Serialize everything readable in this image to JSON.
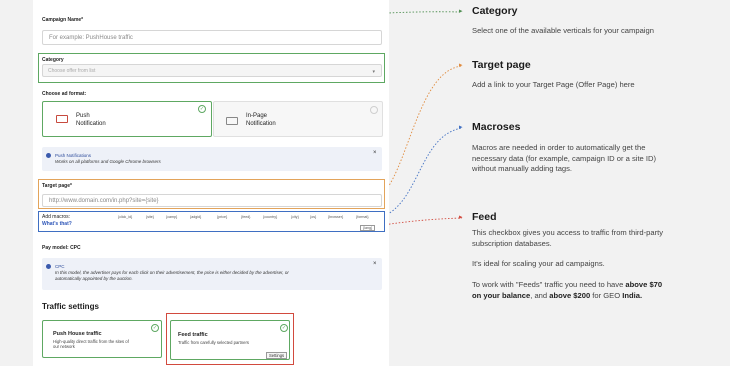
{
  "form": {
    "campaign_name_label": "Campaign Name*",
    "campaign_name_placeholder": "For example: PushHouse traffic",
    "category_label": "Category",
    "category_placeholder": "Choose offer from list",
    "ad_format_label": "Choose ad format:",
    "formats": [
      {
        "title_line1": "Push",
        "title_line2": "Notification",
        "selected": true
      },
      {
        "title_line1": "In-Page",
        "title_line2": "Notification",
        "selected": false
      }
    ],
    "push_note_title": "Push Notifications",
    "push_note_text": "Works on all platforms and Google Chrome browsers",
    "target_page_label": "Target page*",
    "target_page_value": "http://www.domain.com/in.php?site={site}",
    "add_macros_label": "Add macros:",
    "whats_that": "What's that?",
    "macros": [
      "{click_id}",
      "{site}",
      "{camp}",
      "{adgid}",
      "{price}",
      "{feed}",
      "{country}",
      "{city}",
      "{os}",
      "{browser}",
      "{format}"
    ],
    "macro_extra": "{lang}",
    "pay_model_label": "Pay model: CPC",
    "cpc_note_title": "CPC",
    "cpc_note_text_1": "In this model, the advertiser pays for each click on their advertisement, the price is either decided by the advertiser, or",
    "cpc_note_text_2": "automatically appointed by the auction.",
    "traffic_settings_title": "Traffic settings",
    "push_house_title": "Push House traffic",
    "push_house_desc_1": "High-quality direct traffic from the sites of",
    "push_house_desc_2": "our network",
    "feed_title": "Feed traffic",
    "feed_desc": "Traffic from carefully selected partners",
    "settings_label": "Settings",
    "close_symbol": "×"
  },
  "annotations": {
    "category_title": "Category",
    "category_text": "Select one of the available verticals for your campaign",
    "target_title": "Target page",
    "target_text": "Add a link to your Target Page (Offer Page) here",
    "macroses_title": "Macroses",
    "macroses_text_1": "Macros are needed in order to automatically get the",
    "macroses_text_2": "necessary data (for example, campaign ID or a site ID)",
    "macroses_text_3": "without manually adding tags.",
    "feed_title": "Feed",
    "feed_text_1": "This checkbox gives you access to traffic from third-party",
    "feed_text_2": "subscription databases.",
    "feed_text_3": "It's ideal for scaling your ad campaigns.",
    "feed_text_4a": "To work with \"Feeds\" traffic you need to have ",
    "feed_text_4b": "above $70",
    "feed_text_5a": "on your balance",
    "feed_text_5b": ", and ",
    "feed_text_5c": "above $200",
    "feed_text_5d": " for GEO ",
    "feed_text_5e": "India."
  },
  "colors": {
    "category_line": "#4f8f52",
    "target_line": "#e08a3c",
    "macros_line": "#3f6fc2",
    "feed_line": "#d24a3e"
  }
}
